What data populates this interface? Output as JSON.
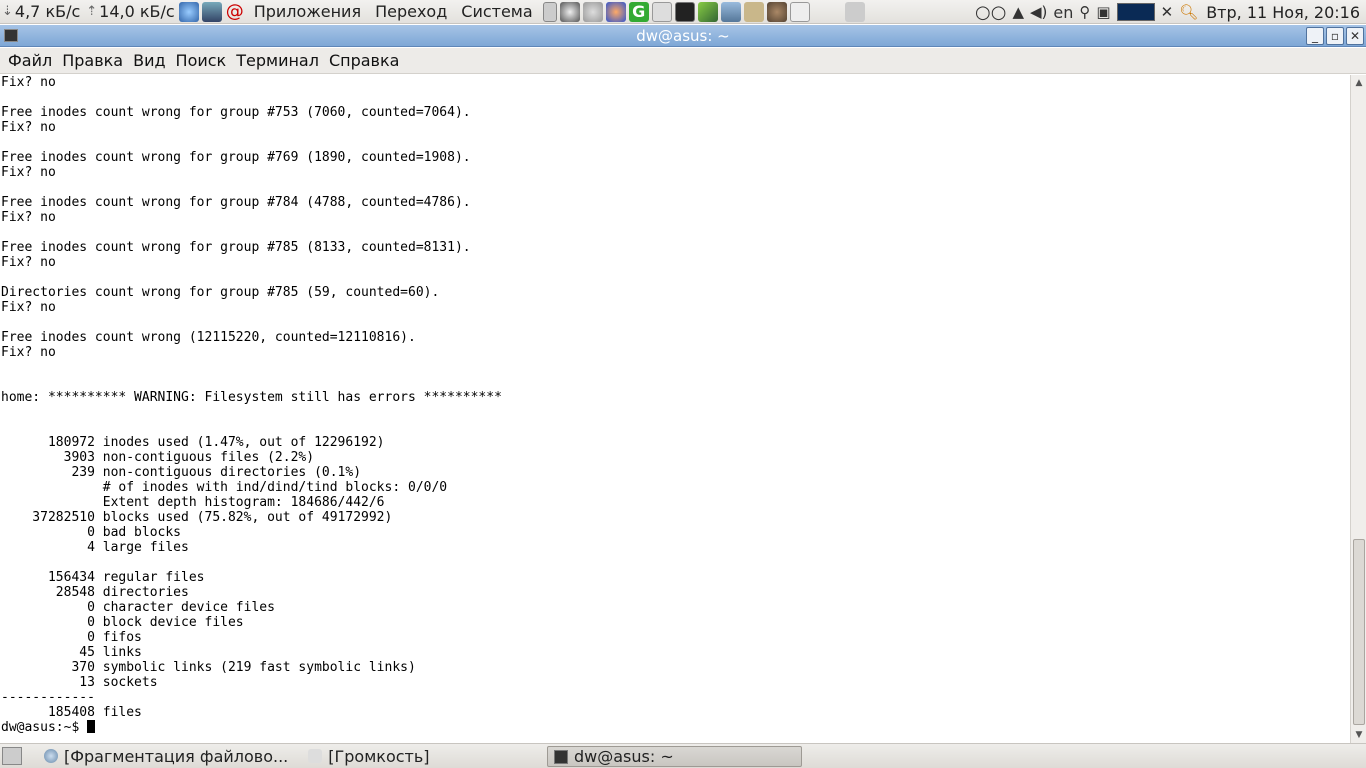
{
  "top_panel": {
    "net_down": "4,7 кБ/с",
    "net_up": "14,0 кБ/с",
    "menu": [
      "Приложения",
      "Переход",
      "Система"
    ],
    "keyboard_layout": "en",
    "clock": "Втр, 11 Ноя, 20:16"
  },
  "window": {
    "title": "dw@asus: ~"
  },
  "menubar": [
    "Файл",
    "Правка",
    "Вид",
    "Поиск",
    "Терминал",
    "Справка"
  ],
  "terminal": {
    "lines": [
      "Fix? no",
      "",
      "Free inodes count wrong for group #753 (7060, counted=7064).",
      "Fix? no",
      "",
      "Free inodes count wrong for group #769 (1890, counted=1908).",
      "Fix? no",
      "",
      "Free inodes count wrong for group #784 (4788, counted=4786).",
      "Fix? no",
      "",
      "Free inodes count wrong for group #785 (8133, counted=8131).",
      "Fix? no",
      "",
      "Directories count wrong for group #785 (59, counted=60).",
      "Fix? no",
      "",
      "Free inodes count wrong (12115220, counted=12110816).",
      "Fix? no",
      "",
      "",
      "home: ********** WARNING: Filesystem still has errors **********",
      "",
      "",
      "      180972 inodes used (1.47%, out of 12296192)",
      "        3903 non-contiguous files (2.2%)",
      "         239 non-contiguous directories (0.1%)",
      "             # of inodes with ind/dind/tind blocks: 0/0/0",
      "             Extent depth histogram: 184686/442/6",
      "    37282510 blocks used (75.82%, out of 49172992)",
      "           0 bad blocks",
      "           4 large files",
      "",
      "      156434 regular files",
      "       28548 directories",
      "           0 character device files",
      "           0 block device files",
      "           0 fifos",
      "          45 links",
      "         370 symbolic links (219 fast symbolic links)",
      "          13 sockets",
      "------------",
      "      185408 files"
    ],
    "prompt": "dw@asus:~$ "
  },
  "bottom_panel": {
    "tasks": [
      "[Фрагментация файлово...",
      "[Громкость]"
    ],
    "active_task": "dw@asus: ~"
  },
  "colors": {
    "titlebar": "#7ea7d6",
    "panel": "#e8e6e3",
    "terminal_bg": "#ffffff"
  }
}
